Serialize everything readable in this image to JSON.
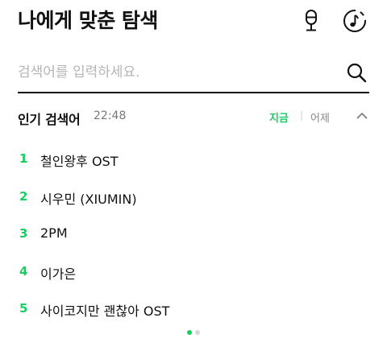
{
  "header": {
    "title": "나에게 맞춘 탐색",
    "icons": {
      "voice": "microphone-icon",
      "music": "music-note-icon"
    }
  },
  "search": {
    "placeholder": "검색어를 입력하세요.",
    "value": "",
    "icon": "search-icon"
  },
  "trending": {
    "title": "인기 검색어",
    "time": "22:48",
    "tabs": {
      "now": "지금",
      "yesterday": "어제",
      "active": "now"
    },
    "collapse_icon": "chevron-up-icon",
    "items": [
      {
        "rank": "1",
        "keyword": "철인왕후 OST"
      },
      {
        "rank": "2",
        "keyword": "시우민 (XIUMIN)"
      },
      {
        "rank": "3",
        "keyword": "2PM"
      },
      {
        "rank": "4",
        "keyword": "이가은"
      },
      {
        "rank": "5",
        "keyword": "사이코지만 괜찮아 OST"
      }
    ],
    "page_indicator": {
      "pages": 2,
      "current": 1
    }
  },
  "colors": {
    "accent": "#19ce60",
    "text": "#111111",
    "muted": "#888888"
  }
}
